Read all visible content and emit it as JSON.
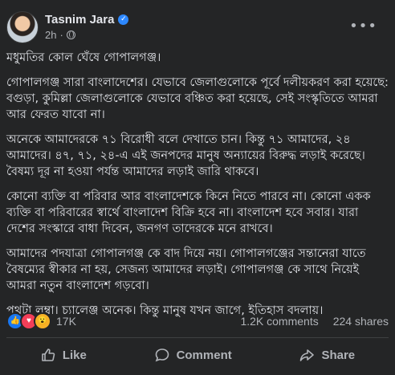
{
  "post": {
    "author": "Tasnim Jara",
    "time": "2h",
    "more": "•••",
    "paragraphs": [
      "মধুমতির কোল ঘেঁষে গোপালগঞ্জ।",
      "গোপালগঞ্জ সারা বাংলাদেশের। যেভাবে জেলাগুলোকে পূর্বে দলীয়করণ করা হয়েছে: বগুড়া, কুমিল্লা জেলাগুলোকে যেভাবে বঞ্চিত করা হয়েছে, সেই সংস্কৃতিতে আমরা আর ফেরত যাবো না।",
      "অনেকে আমাদেরকে ৭১ বিরোধী বলে দেখাতে চান। কিন্তু ৭১ আমাদের, ২৪ আমাদের। ৪৭, ৭১, ২৪-এ এই জনপদের মানুষ অন্যায়ের বিরুদ্ধ লড়াই করেছে। বৈষম্য দূর না হওয়া পর্যন্ত আমাদের লড়াই জারি থাকবে।",
      "কোনো ব্যক্তি বা পরিবার আর বাংলাদেশকে কিনে নিতে পারবে না। কোনো একক ব্যক্তি বা পরিবারের স্বার্থে বাংলাদেশ বিক্রি হবে না। বাংলাদেশ হবে সবার। যারা দেশের সংস্কারে বাধা দিবেন, জনগণ তাদেরকে মনে রাখবে।",
      "আমাদের পদযাত্রা গোপালগঞ্জ কে বাদ দিয়ে নয়। গোপালগঞ্জের সন্তানেরা যাতে বৈষম্যের স্বীকার না হয়, সেজন্য আমাদের লড়াই। গোপালগঞ্জ কে সাথে নিয়েই আমরা নতুন বাংলাদেশ গড়বো।",
      "পথটা লম্বা। চ্যালেঞ্জ অনেক। কিন্তু মানুষ যখন জাগে, ইতিহাস বদলায়।"
    ]
  },
  "stats": {
    "reactions_count": "17K",
    "comments": "1.2K comments",
    "shares": "224 shares"
  },
  "actions": {
    "like": "Like",
    "comment": "Comment",
    "share": "Share"
  },
  "colors": {
    "background": "#242526",
    "text": "#e4e6eb",
    "muted": "#b0b3b8",
    "verified": "#2d88ff"
  }
}
